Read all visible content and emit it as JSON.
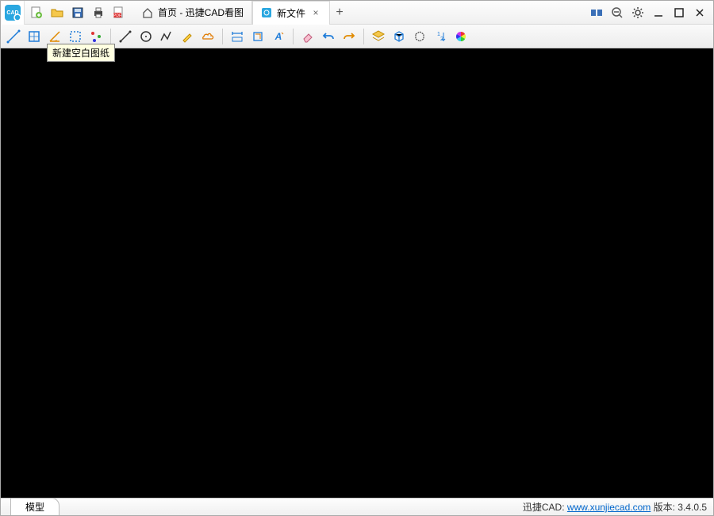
{
  "app": {
    "name": "迅捷CAD"
  },
  "tabs": {
    "home": "首页 - 迅捷CAD看图",
    "file": "新文件"
  },
  "tooltip": {
    "newblank": "新建空白图纸"
  },
  "bottom": {
    "model": "模型",
    "brand": "迅捷CAD: ",
    "url": "www.xunjiecad.com",
    "versionlabel": " 版本: ",
    "version": "3.4.0.5"
  }
}
